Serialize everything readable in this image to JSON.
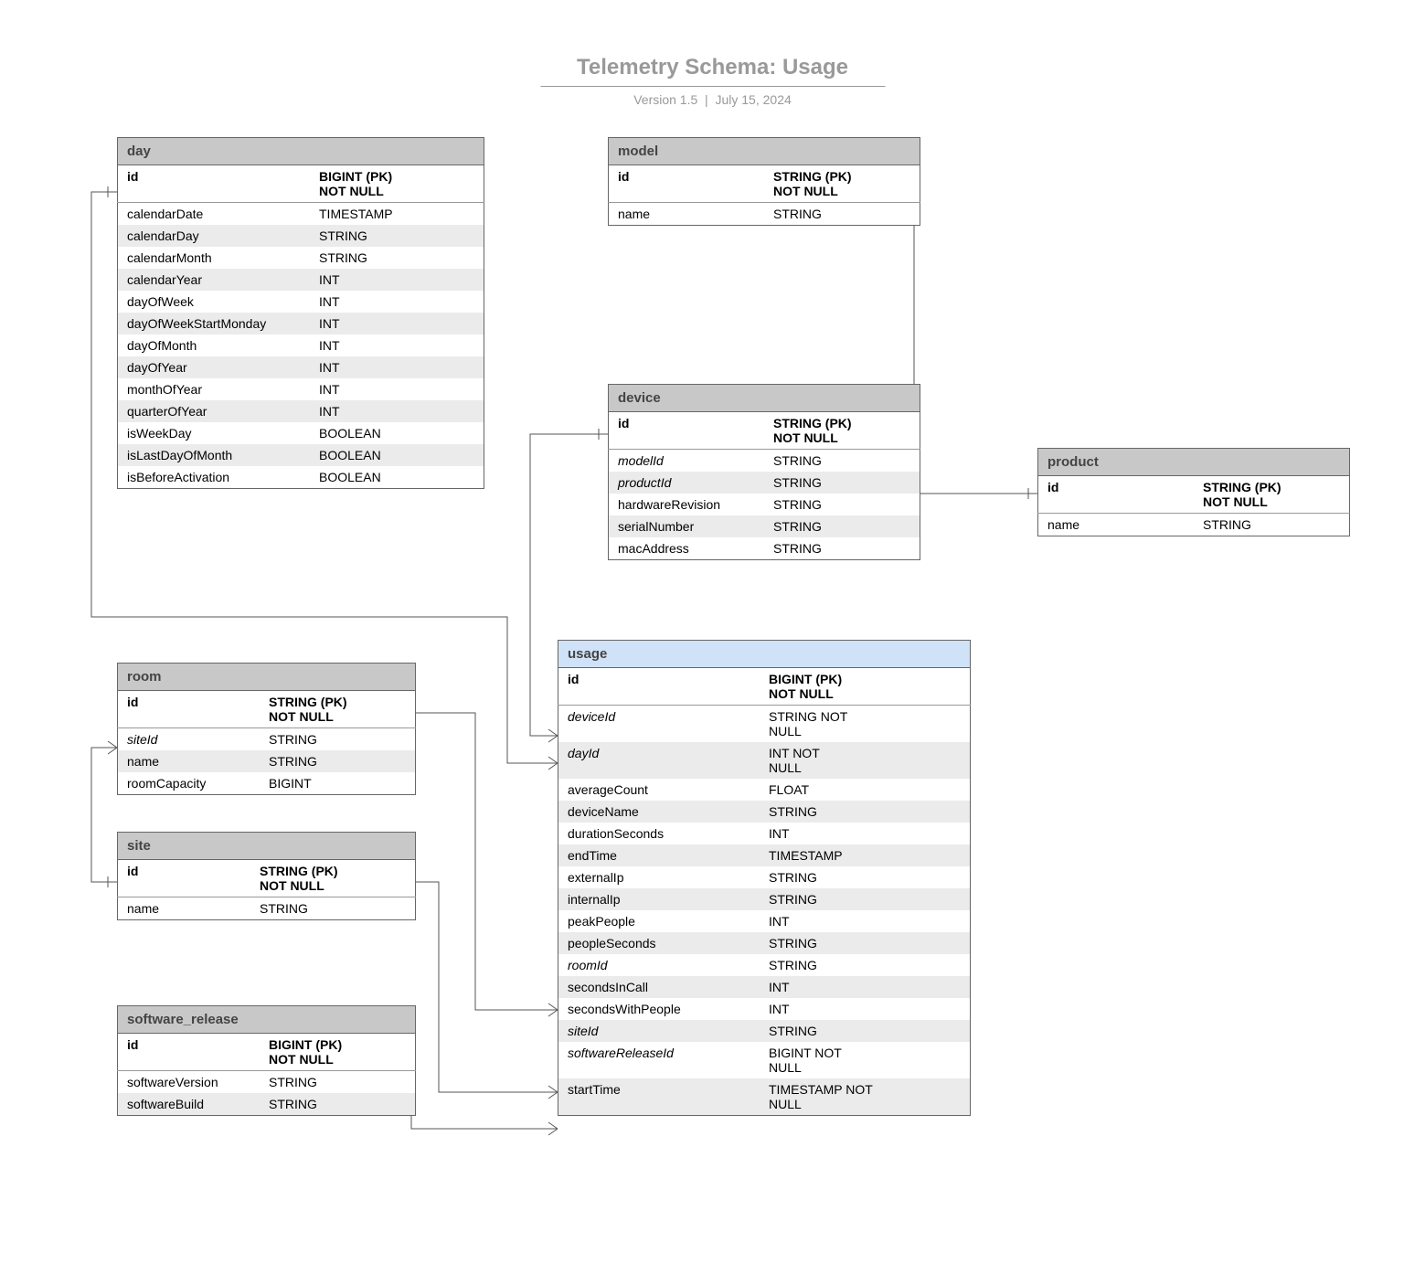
{
  "header": {
    "title": "Telemetry Schema: Usage",
    "version": "Version 1.5",
    "date": "July 15, 2024"
  },
  "entities": {
    "day": {
      "name": "day",
      "rows": [
        {
          "name": "id",
          "type": "BIGINT (PK) NOT NULL",
          "pk": true
        },
        {
          "name": "calendarDate",
          "type": "TIMESTAMP"
        },
        {
          "name": "calendarDay",
          "type": "STRING"
        },
        {
          "name": "calendarMonth",
          "type": "STRING"
        },
        {
          "name": "calendarYear",
          "type": "INT"
        },
        {
          "name": "dayOfWeek",
          "type": "INT"
        },
        {
          "name": "dayOfWeekStartMonday",
          "type": "INT"
        },
        {
          "name": "dayOfMonth",
          "type": "INT"
        },
        {
          "name": "dayOfYear",
          "type": "INT"
        },
        {
          "name": "monthOfYear",
          "type": "INT"
        },
        {
          "name": "quarterOfYear",
          "type": "INT"
        },
        {
          "name": "isWeekDay",
          "type": "BOOLEAN"
        },
        {
          "name": "isLastDayOfMonth",
          "type": "BOOLEAN"
        },
        {
          "name": "isBeforeActivation",
          "type": "BOOLEAN"
        }
      ]
    },
    "model": {
      "name": "model",
      "rows": [
        {
          "name": "id",
          "type": "STRING (PK) NOT NULL",
          "pk": true
        },
        {
          "name": "name",
          "type": "STRING"
        }
      ]
    },
    "device": {
      "name": "device",
      "rows": [
        {
          "name": "id",
          "type": "STRING (PK) NOT NULL",
          "pk": true
        },
        {
          "name": "modelId",
          "type": "STRING",
          "fk": true
        },
        {
          "name": "productId",
          "type": "STRING",
          "fk": true
        },
        {
          "name": "hardwareRevision",
          "type": "STRING"
        },
        {
          "name": "serialNumber",
          "type": "STRING"
        },
        {
          "name": "macAddress",
          "type": "STRING"
        }
      ]
    },
    "product": {
      "name": "product",
      "rows": [
        {
          "name": "id",
          "type": "STRING (PK) NOT NULL",
          "pk": true
        },
        {
          "name": "name",
          "type": "STRING"
        }
      ]
    },
    "room": {
      "name": "room",
      "rows": [
        {
          "name": "id",
          "type": "STRING (PK) NOT NULL",
          "pk": true
        },
        {
          "name": "siteId",
          "type": "STRING",
          "fk": true
        },
        {
          "name": "name",
          "type": "STRING"
        },
        {
          "name": "roomCapacity",
          "type": "BIGINT"
        }
      ]
    },
    "site": {
      "name": "site",
      "rows": [
        {
          "name": "id",
          "type": "STRING (PK) NOT NULL",
          "pk": true
        },
        {
          "name": "name",
          "type": "STRING"
        }
      ]
    },
    "software_release": {
      "name": "software_release",
      "rows": [
        {
          "name": "id",
          "type": "BIGINT (PK) NOT NULL",
          "pk": true
        },
        {
          "name": "softwareVersion",
          "type": "STRING"
        },
        {
          "name": "softwareBuild",
          "type": "STRING"
        }
      ]
    },
    "usage": {
      "name": "usage",
      "highlight": true,
      "rows": [
        {
          "name": "id",
          "type": "BIGINT (PK) NOT NULL",
          "pk": true
        },
        {
          "name": "deviceId",
          "type": "STRING NOT NULL",
          "fk": true
        },
        {
          "name": "dayId",
          "type": "INT NOT NULL",
          "fk": true
        },
        {
          "name": "averageCount",
          "type": "FLOAT"
        },
        {
          "name": "deviceName",
          "type": "STRING"
        },
        {
          "name": "durationSeconds",
          "type": "INT"
        },
        {
          "name": "endTime",
          "type": "TIMESTAMP"
        },
        {
          "name": "externalIp",
          "type": "STRING"
        },
        {
          "name": "internalIp",
          "type": "STRING"
        },
        {
          "name": "peakPeople",
          "type": "INT"
        },
        {
          "name": "peopleSeconds",
          "type": "STRING"
        },
        {
          "name": "roomId",
          "type": "STRING",
          "fk": true
        },
        {
          "name": "secondsInCall",
          "type": "INT"
        },
        {
          "name": "secondsWithPeople",
          "type": "INT"
        },
        {
          "name": "siteId",
          "type": "STRING",
          "fk": true
        },
        {
          "name": "softwareReleaseId",
          "type": "BIGINT NOT NULL",
          "fk": true
        },
        {
          "name": "startTime",
          "type": "TIMESTAMP NOT NULL"
        }
      ]
    }
  },
  "relationships": [
    {
      "from": "usage.dayId",
      "to": "day.id"
    },
    {
      "from": "usage.deviceId",
      "to": "device.id"
    },
    {
      "from": "usage.roomId",
      "to": "room.id"
    },
    {
      "from": "usage.siteId",
      "to": "site.id"
    },
    {
      "from": "usage.softwareReleaseId",
      "to": "software_release.id"
    },
    {
      "from": "device.modelId",
      "to": "model.id"
    },
    {
      "from": "device.productId",
      "to": "product.id"
    },
    {
      "from": "room.siteId",
      "to": "site.id"
    }
  ]
}
